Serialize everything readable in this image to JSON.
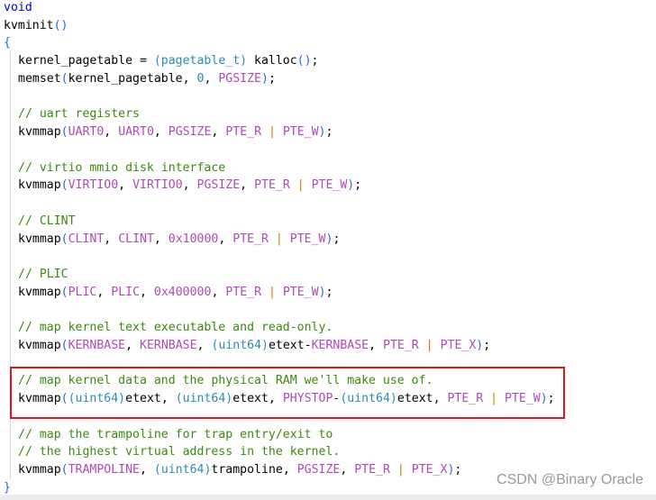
{
  "code_lines": [
    {
      "indent": false,
      "tokens": [
        [
          "void",
          "kw"
        ]
      ]
    },
    {
      "indent": false,
      "tokens": [
        [
          "kvminit",
          "fn"
        ],
        [
          "()",
          "par"
        ]
      ]
    },
    {
      "indent": false,
      "tokens": [
        [
          "{",
          "par"
        ]
      ]
    },
    {
      "indent": true,
      "tokens": [
        [
          "kernel_pagetable = ",
          "pl"
        ],
        [
          "(pagetable_t)",
          "ty"
        ],
        [
          " kalloc",
          "fn"
        ],
        [
          "()",
          "par"
        ],
        [
          ";",
          "pl"
        ]
      ]
    },
    {
      "indent": true,
      "tokens": [
        [
          "memset",
          "fn"
        ],
        [
          "(",
          "par"
        ],
        [
          "kernel_pagetable, ",
          "pl"
        ],
        [
          "0",
          "num"
        ],
        [
          ", ",
          "pl"
        ],
        [
          "PGSIZE",
          "mac"
        ],
        [
          ")",
          "par"
        ],
        [
          ";",
          "pl"
        ]
      ]
    },
    {
      "indent": true,
      "tokens": []
    },
    {
      "indent": true,
      "tokens": [
        [
          "// uart registers",
          "cm"
        ]
      ]
    },
    {
      "indent": true,
      "tokens": [
        [
          "kvmmap",
          "fn"
        ],
        [
          "(",
          "par"
        ],
        [
          "UART0",
          "mac"
        ],
        [
          ", ",
          "pl"
        ],
        [
          "UART0",
          "mac"
        ],
        [
          ", ",
          "pl"
        ],
        [
          "PGSIZE",
          "mac"
        ],
        [
          ", ",
          "pl"
        ],
        [
          "PTE_R",
          "mac"
        ],
        [
          " | ",
          "op"
        ],
        [
          "PTE_W",
          "mac"
        ],
        [
          ")",
          "par"
        ],
        [
          ";",
          "pl"
        ]
      ]
    },
    {
      "indent": true,
      "tokens": []
    },
    {
      "indent": true,
      "tokens": [
        [
          "// virtio mmio disk interface",
          "cm"
        ]
      ]
    },
    {
      "indent": true,
      "tokens": [
        [
          "kvmmap",
          "fn"
        ],
        [
          "(",
          "par"
        ],
        [
          "VIRTIO0",
          "mac"
        ],
        [
          ", ",
          "pl"
        ],
        [
          "VIRTIO0",
          "mac"
        ],
        [
          ", ",
          "pl"
        ],
        [
          "PGSIZE",
          "mac"
        ],
        [
          ", ",
          "pl"
        ],
        [
          "PTE_R",
          "mac"
        ],
        [
          " | ",
          "op"
        ],
        [
          "PTE_W",
          "mac"
        ],
        [
          ")",
          "par"
        ],
        [
          ";",
          "pl"
        ]
      ]
    },
    {
      "indent": true,
      "tokens": []
    },
    {
      "indent": true,
      "tokens": [
        [
          "// CLINT",
          "cm"
        ]
      ]
    },
    {
      "indent": true,
      "tokens": [
        [
          "kvmmap",
          "fn"
        ],
        [
          "(",
          "par"
        ],
        [
          "CLINT",
          "mac"
        ],
        [
          ", ",
          "pl"
        ],
        [
          "CLINT",
          "mac"
        ],
        [
          ", ",
          "pl"
        ],
        [
          "0x10000",
          "mac"
        ],
        [
          ", ",
          "pl"
        ],
        [
          "PTE_R",
          "mac"
        ],
        [
          " | ",
          "op"
        ],
        [
          "PTE_W",
          "mac"
        ],
        [
          ")",
          "par"
        ],
        [
          ";",
          "pl"
        ]
      ]
    },
    {
      "indent": true,
      "tokens": []
    },
    {
      "indent": true,
      "tokens": [
        [
          "// PLIC",
          "cm"
        ]
      ]
    },
    {
      "indent": true,
      "tokens": [
        [
          "kvmmap",
          "fn"
        ],
        [
          "(",
          "par"
        ],
        [
          "PLIC",
          "mac"
        ],
        [
          ", ",
          "pl"
        ],
        [
          "PLIC",
          "mac"
        ],
        [
          ", ",
          "pl"
        ],
        [
          "0x400000",
          "mac"
        ],
        [
          ", ",
          "pl"
        ],
        [
          "PTE_R",
          "mac"
        ],
        [
          " | ",
          "op"
        ],
        [
          "PTE_W",
          "mac"
        ],
        [
          ")",
          "par"
        ],
        [
          ";",
          "pl"
        ]
      ]
    },
    {
      "indent": true,
      "tokens": []
    },
    {
      "indent": true,
      "tokens": [
        [
          "// map kernel text executable and read-only.",
          "cm"
        ]
      ]
    },
    {
      "indent": true,
      "tokens": [
        [
          "kvmmap",
          "fn"
        ],
        [
          "(",
          "par"
        ],
        [
          "KERNBASE",
          "mac"
        ],
        [
          ", ",
          "pl"
        ],
        [
          "KERNBASE",
          "mac"
        ],
        [
          ", ",
          "pl"
        ],
        [
          "(uint64)",
          "ty"
        ],
        [
          "etext-",
          "pl"
        ],
        [
          "KERNBASE",
          "mac"
        ],
        [
          ", ",
          "pl"
        ],
        [
          "PTE_R",
          "mac"
        ],
        [
          " | ",
          "op"
        ],
        [
          "PTE_X",
          "mac"
        ],
        [
          ")",
          "par"
        ],
        [
          ";",
          "pl"
        ]
      ]
    },
    {
      "indent": true,
      "tokens": []
    },
    {
      "indent": true,
      "tokens": [
        [
          "// map kernel data and the physical RAM we'll make use of.",
          "cm"
        ]
      ]
    },
    {
      "indent": true,
      "tokens": [
        [
          "kvmmap",
          "fn"
        ],
        [
          "(",
          "par"
        ],
        [
          "(uint64)",
          "ty"
        ],
        [
          "etext, ",
          "pl"
        ],
        [
          "(uint64)",
          "ty"
        ],
        [
          "etext, ",
          "pl"
        ],
        [
          "PHYSTOP",
          "mac"
        ],
        [
          "-",
          "pl"
        ],
        [
          "(uint64)",
          "ty"
        ],
        [
          "etext, ",
          "pl"
        ],
        [
          "PTE_R",
          "mac"
        ],
        [
          " | ",
          "op"
        ],
        [
          "PTE_W",
          "mac"
        ],
        [
          ")",
          "par"
        ],
        [
          ";",
          "pl"
        ]
      ]
    },
    {
      "indent": true,
      "tokens": []
    },
    {
      "indent": true,
      "tokens": [
        [
          "// map the trampoline for trap entry/exit to",
          "cm"
        ]
      ]
    },
    {
      "indent": true,
      "tokens": [
        [
          "// the highest virtual address in the kernel.",
          "cm"
        ]
      ]
    },
    {
      "indent": true,
      "tokens": [
        [
          "kvmmap",
          "fn"
        ],
        [
          "(",
          "par"
        ],
        [
          "TRAMPOLINE",
          "mac"
        ],
        [
          ", ",
          "pl"
        ],
        [
          "(uint64)",
          "ty"
        ],
        [
          "trampoline, ",
          "pl"
        ],
        [
          "PGSIZE",
          "mac"
        ],
        [
          ", ",
          "pl"
        ],
        [
          "PTE_R",
          "mac"
        ],
        [
          " | ",
          "op"
        ],
        [
          "PTE_X",
          "mac"
        ],
        [
          ")",
          "par"
        ],
        [
          ";",
          "pl"
        ]
      ]
    },
    {
      "indent": false,
      "tokens": [
        [
          "}",
          "par"
        ]
      ]
    }
  ],
  "highlight_color": "#e0151f",
  "watermark": "CSDN @Binary Oracle"
}
